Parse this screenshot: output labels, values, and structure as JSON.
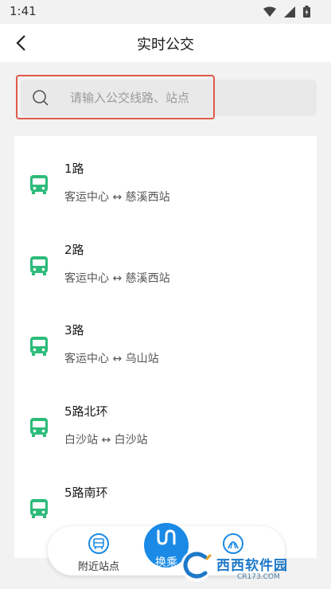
{
  "status_bar": {
    "time": "1:41"
  },
  "header": {
    "title": "实时公交"
  },
  "search": {
    "placeholder": "请输入公交线路、站点"
  },
  "routes": [
    {
      "name": "1路",
      "stops": "客运中心 ↔ 慈溪西站"
    },
    {
      "name": "2路",
      "stops": "客运中心 ↔ 慈溪西站"
    },
    {
      "name": "3路",
      "stops": "客运中心 ↔ 乌山站"
    },
    {
      "name": "5路北环",
      "stops": "白沙站 ↔ 白沙站"
    },
    {
      "name": "5路南环",
      "stops": ""
    }
  ],
  "bottom_nav": {
    "nearby_label": "附近站点",
    "transfer_label": "换乘"
  },
  "watermark": {
    "text": "西西软件园",
    "sub": "CR173.COM"
  },
  "colors": {
    "bus_green": "#2dbb7a",
    "accent_blue": "#1a8ae6",
    "search_highlight": "#e05a4a"
  }
}
